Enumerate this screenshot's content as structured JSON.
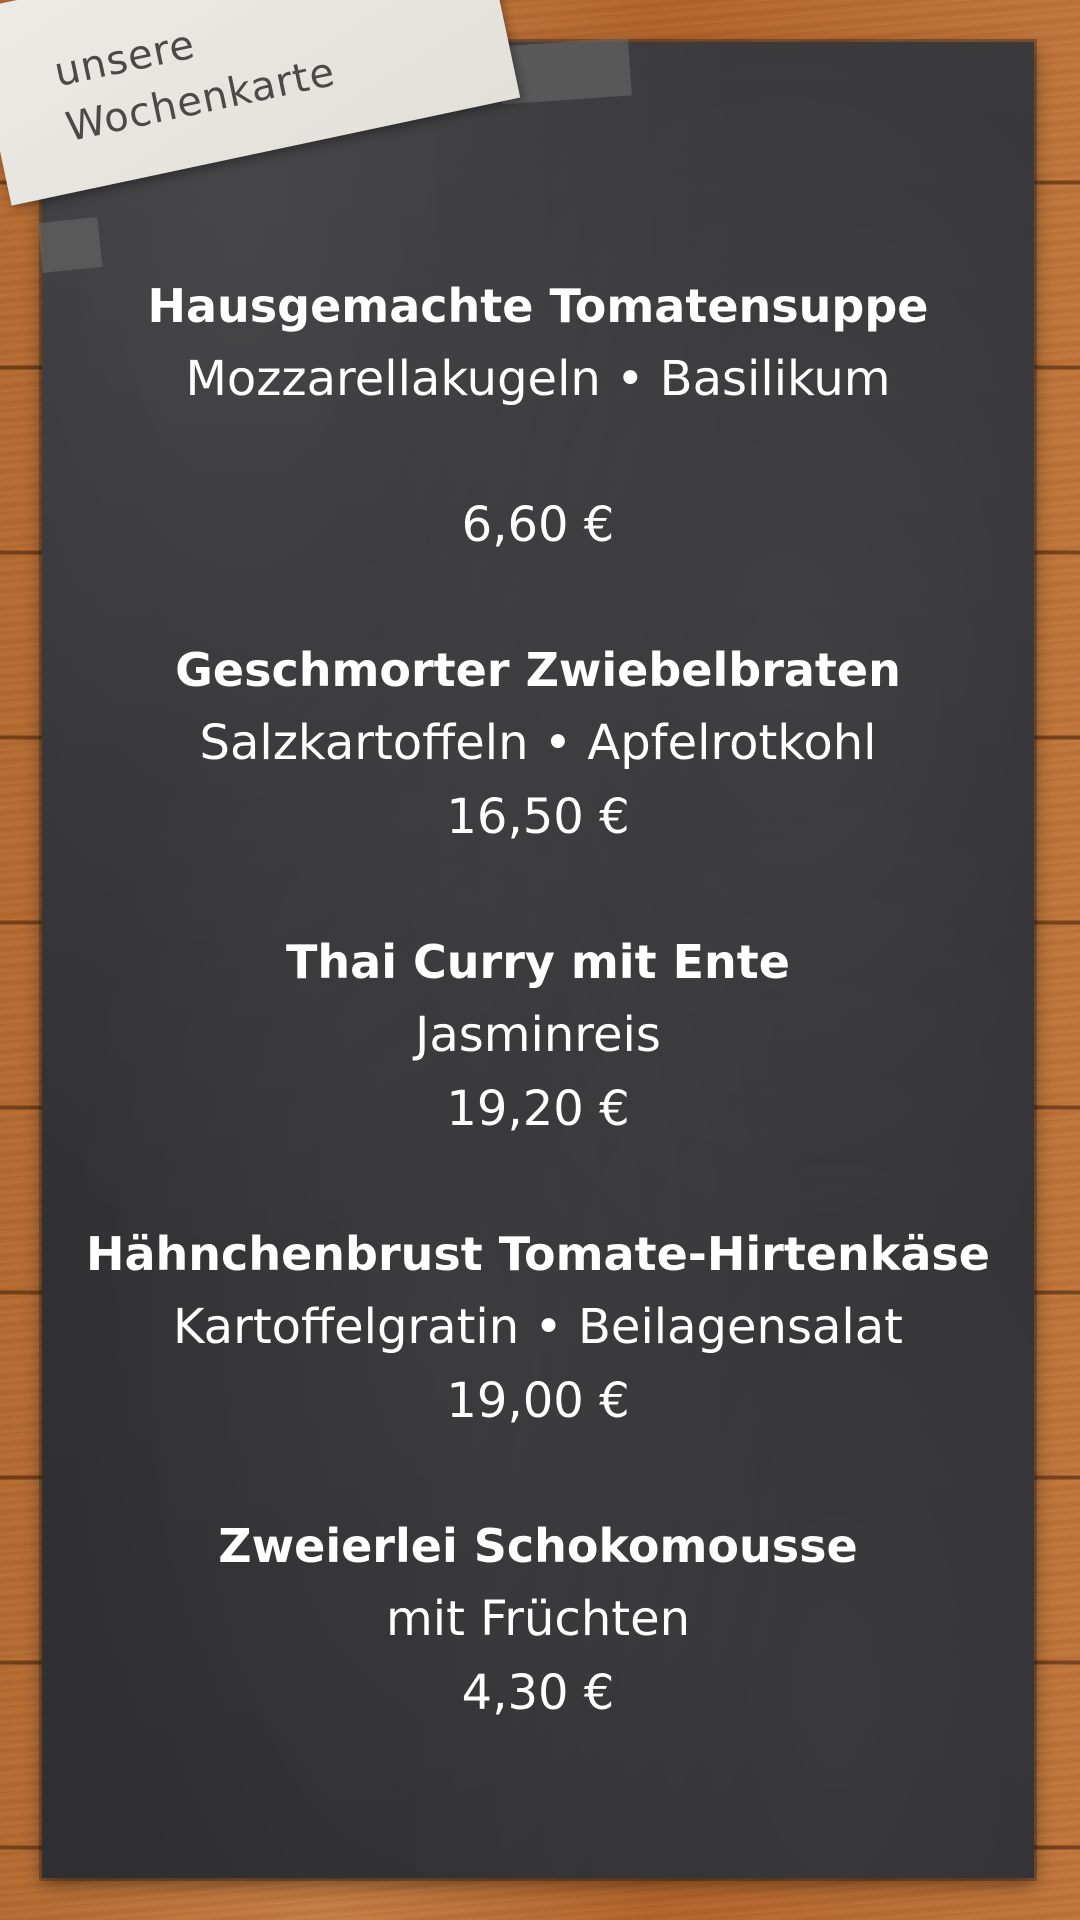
{
  "note": {
    "line1": "unsere",
    "line2": "Wochenkarte"
  },
  "dishes": [
    {
      "name": "Hausgemachte Tomatensuppe",
      "description": "Mozzarellakugeln • Basilikum",
      "price": "6,60 €"
    },
    {
      "name": "Geschmorter Zwiebelbraten",
      "description": "Salzkartoffeln • Apfelrotkohl",
      "price": "16,50 €"
    },
    {
      "name": "Thai Curry mit Ente",
      "description": "Jasminreis",
      "price": "19,20 €"
    },
    {
      "name": "Hähnchenbrust Tomate-Hirtenkäse",
      "description": "Kartoffelgratin • Beilagensalat",
      "price": "19,00 €"
    },
    {
      "name": "Zweierlei Schokomousse",
      "description": "mit Früchten",
      "price": "4,30 €"
    }
  ],
  "colors": {
    "chalkboard": "#333335",
    "text": "#ffffff",
    "wood": "#c47a3f",
    "note": "#e8e7e1"
  }
}
